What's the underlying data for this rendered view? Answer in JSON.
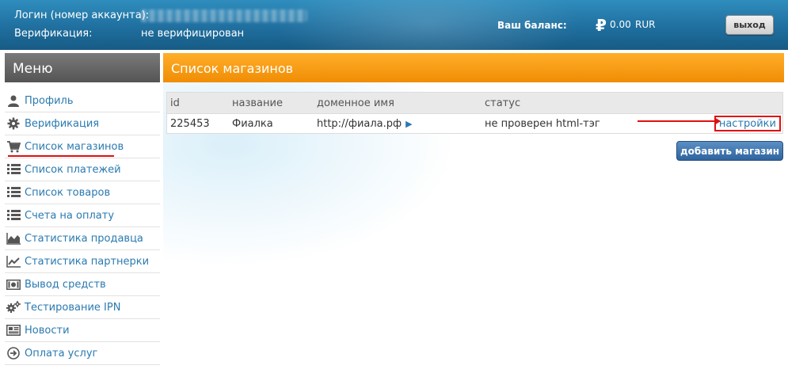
{
  "header": {
    "login_label": "Логин (номер аккаунта):",
    "verification_label": "Верификация:",
    "verification_value": "не верифицирован",
    "balance_label": "Ваш баланс:",
    "currency_symbol": "₽",
    "balance_amount": "0.00",
    "balance_currency": "RUR",
    "logout_label": "выход"
  },
  "menu": {
    "title": "Меню",
    "items": [
      {
        "label": "Профиль",
        "icon": "user-icon"
      },
      {
        "label": "Верификация",
        "icon": "gear-icon"
      },
      {
        "label": "Список магазинов",
        "icon": "cart-icon",
        "active": true
      },
      {
        "label": "Список платежей",
        "icon": "list-icon"
      },
      {
        "label": "Список товаров",
        "icon": "list-icon"
      },
      {
        "label": "Счета на оплату",
        "icon": "list-icon"
      },
      {
        "label": "Статистика продавца",
        "icon": "area-chart-icon"
      },
      {
        "label": "Статистика партнерки",
        "icon": "line-chart-icon"
      },
      {
        "label": "Вывод средств",
        "icon": "money-icon"
      },
      {
        "label": "Тестирование IPN",
        "icon": "gears-icon"
      },
      {
        "label": "Новости",
        "icon": "newspaper-icon"
      },
      {
        "label": "Оплата услуг",
        "icon": "arrow-circle-icon"
      }
    ]
  },
  "main": {
    "title": "Список магазинов",
    "table": {
      "columns": [
        "id",
        "название",
        "доменное имя",
        "статус"
      ],
      "rows": [
        {
          "id": "225453",
          "name": "Фиалка",
          "domain": "http://фиала.рф",
          "status": "не проверен html-тэг",
          "action": "настройки"
        }
      ]
    },
    "add_button_label": "добавить магазин"
  },
  "colors": {
    "header_blue": "#1f6f9f",
    "orange": "#f08d05",
    "link": "#2a7ab0",
    "highlight_red": "#e01010"
  }
}
